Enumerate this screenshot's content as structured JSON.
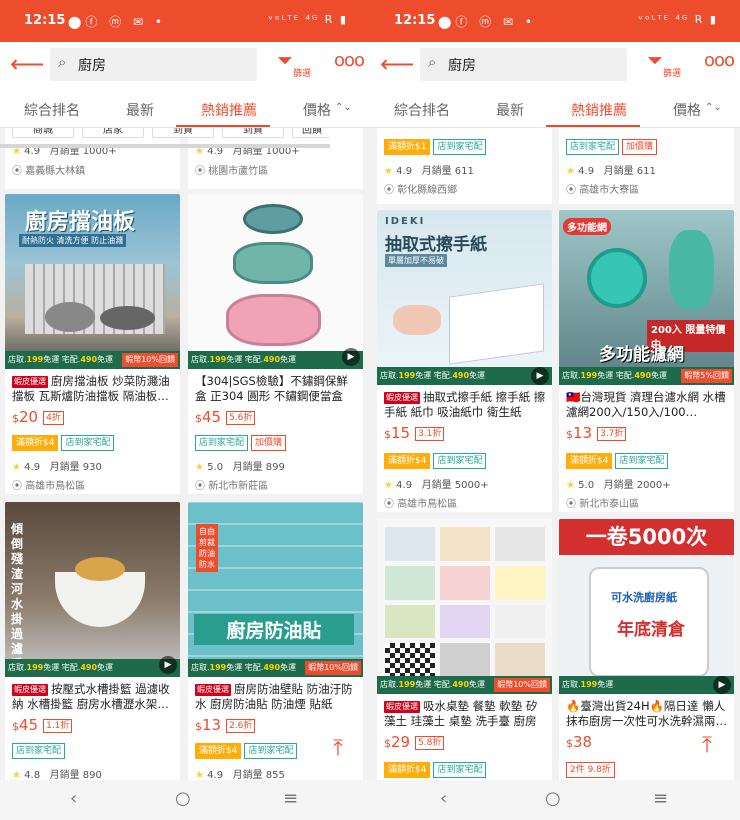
{
  "status": {
    "time": "12:15",
    "right": "ᵛᵒᴸᵀᴱ ⁴ᴳ R ▮"
  },
  "search": {
    "query": "廚房",
    "filter_label": "篩選",
    "more": "ooo"
  },
  "tabs": [
    "綜合排名",
    "最新",
    "熱銷推薦",
    "價格"
  ],
  "price_sort_icon": "⌃⌄",
  "strip": {
    "take": "店取.",
    "take_v": "199",
    "free1": "免運",
    "home": "宅配.",
    "home_v": "490",
    "free2": "免運",
    "shrimp": "蝦幣10%回饋",
    "shrimp5": "蝦幣5%回饋"
  },
  "left": {
    "subchips": [
      "商城",
      "店家",
      "到貨",
      "到貨",
      "回饋"
    ],
    "cards": [
      {
        "rating": "4.9",
        "sold": "月銷量 1000+",
        "loc": "嘉義縣大林鎮"
      },
      {
        "rating": "4.9",
        "sold": "月銷量 1000+",
        "loc": "桃園市蘆竹區"
      },
      {
        "img_text": "廚房擋油板",
        "img_sub": "耐熱防火 清洗方便 防止油濺",
        "mall": "蝦皮優選",
        "title": "廚房擋油板 炒菜防濺油擋板 瓦斯爐防油擋板 隔油板…",
        "price": "20",
        "disc": "4折",
        "tags": [
          "滿額折$4",
          "店到家宅配"
        ],
        "rating": "4.9",
        "sold": "月銷量 930",
        "loc": "高雄市鳥松區"
      },
      {
        "title": "【304|SGS檢驗】不鏽鋼保鮮盒 正304 圓形 不鏽鋼便當盒 不鏽…",
        "price": "45",
        "disc": "5.6折",
        "tags": [
          "店到家宅配",
          "加價購"
        ],
        "rating": "5.0",
        "sold": "月銷量 899",
        "loc": "新北市新莊區"
      },
      {
        "img_text": "傾倒殘渣 河水 掛 過濾 手 水槽",
        "mall": "蝦皮優選",
        "title": "按壓式水槽掛籃 過濾收納 水槽掛籃 廚房水槽瀝水架…",
        "price": "45",
        "disc": "1.1折",
        "tags": [
          "店到家宅配"
        ],
        "rating": "4.8",
        "sold": "月銷量 890"
      },
      {
        "img_text": "廚房防油貼",
        "img_sub": "自由剪裁 防油 防水",
        "mall": "蝦皮優選",
        "title": "廚房防油壁貼 防油汙防水 廚房防油貼 防油煙 貼紙 廚…",
        "price": "13",
        "disc": "2.6折",
        "tags": [
          "滿額折$4",
          "店到家宅配"
        ],
        "rating": "4.9",
        "sold": "月銷量 855"
      }
    ]
  },
  "right": {
    "cards": [
      {
        "tags": [
          "滿額折$1",
          "店到家宅配"
        ],
        "rating": "4.9",
        "sold": "月銷量 611",
        "loc": "彰化縣線西鄉"
      },
      {
        "tags": [
          "店到家宅配",
          "加價購"
        ],
        "rating": "4.9",
        "sold": "月銷量 611",
        "loc": "高雄市大寮區"
      },
      {
        "img_brand": "IDEKI",
        "img_text": "抽取式擦手紙",
        "img_sub": "單層加厚不易破",
        "mall": "蝦皮優選",
        "title": "抽取式擦手紙 擦手紙 擦手紙 紙巾 吸油紙巾 衛生紙 抽…",
        "price": "15",
        "disc": "3.1折",
        "tags": [
          "滿額折$4",
          "店到家宅配"
        ],
        "rating": "4.9",
        "sold": "月銷量 5000+",
        "loc": "高雄市鳥松區"
      },
      {
        "img_text": "多功能濾網",
        "img_sub": "200入 限量特價中",
        "img_badge": "多功能網",
        "flag": "🇹🇼",
        "title": "台灣現貨 濟理台濾水網 水槽濾網200入/150入/100…",
        "price": "13",
        "disc": "3.7折",
        "tags": [
          "滿額折$4",
          "店到家宅配"
        ],
        "rating": "5.0",
        "sold": "月銷量 2000+",
        "loc": "新北市泰山區"
      },
      {
        "mall": "蝦皮優選",
        "title": "吸水桌墊 餐墊 軟墊 矽藻土 珪藻土 桌墊 洗手臺 廚房 防…",
        "price": "29",
        "disc": "5.8折",
        "tags": [
          "滿額折$4",
          "店到家宅配"
        ]
      },
      {
        "img_text": "一卷5000次",
        "img_sub": "可水洗廚房紙",
        "img_sub2": "年底清倉",
        "title": "🔥臺灣出貨24H🔥隔日達 懶人抹布廚房一次性可水洗幹濕兩…",
        "price": "38",
        "promo": "2件 9.8折"
      }
    ]
  },
  "colors": {
    "brand": "#ee4d2d",
    "teal": "#26aa99",
    "strip": "#1d6b4a"
  }
}
